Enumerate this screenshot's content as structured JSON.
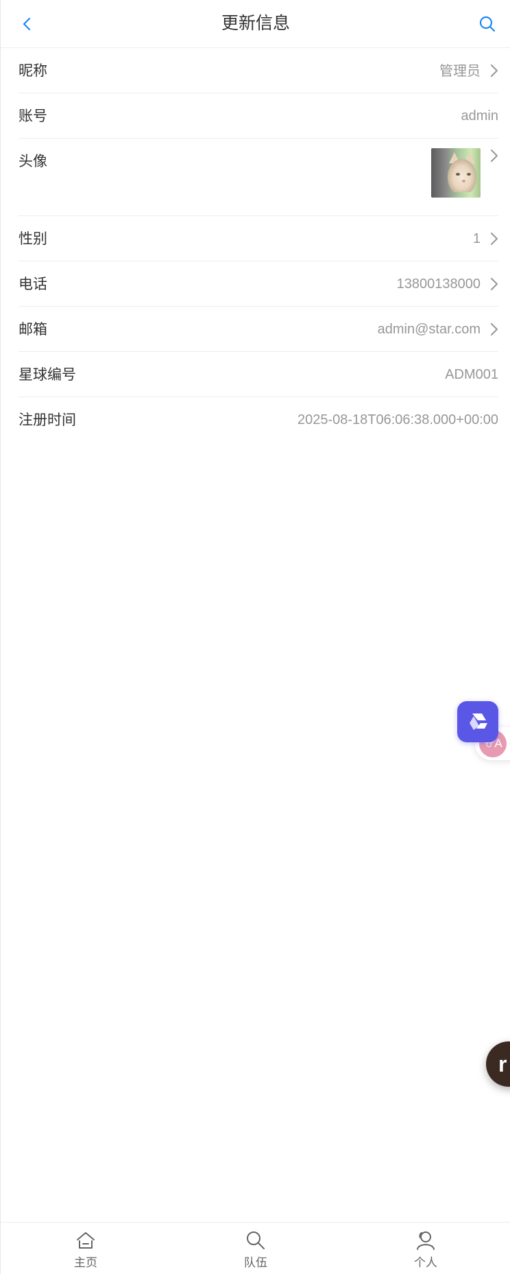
{
  "header": {
    "title": "更新信息",
    "back_icon": "chevron-left-icon",
    "search_icon": "search-icon",
    "accent_color": "#1989fa"
  },
  "fields": [
    {
      "label": "昵称",
      "value": "管理员",
      "has_arrow": true
    },
    {
      "label": "账号",
      "value": "admin",
      "has_arrow": false
    },
    {
      "label": "头像",
      "value": "",
      "has_arrow": true,
      "type": "avatar"
    },
    {
      "label": "性别",
      "value": "1",
      "has_arrow": true
    },
    {
      "label": "电话",
      "value": "13800138000",
      "has_arrow": true
    },
    {
      "label": "邮箱",
      "value": "admin@star.com",
      "has_arrow": true
    },
    {
      "label": "星球编号",
      "value": "ADM001",
      "has_arrow": false
    },
    {
      "label": "注册时间",
      "value": "2025-08-18T06:06:38.000+00:00",
      "has_arrow": false
    }
  ],
  "floating": {
    "ai_assistant_color": "#5a57e6",
    "translate_badge": "ꕢA",
    "dark_button_letter": "r"
  },
  "tabbar": {
    "items": [
      {
        "label": "主页",
        "icon": "home-icon"
      },
      {
        "label": "队伍",
        "icon": "search-icon"
      },
      {
        "label": "个人",
        "icon": "user-icon"
      }
    ]
  }
}
